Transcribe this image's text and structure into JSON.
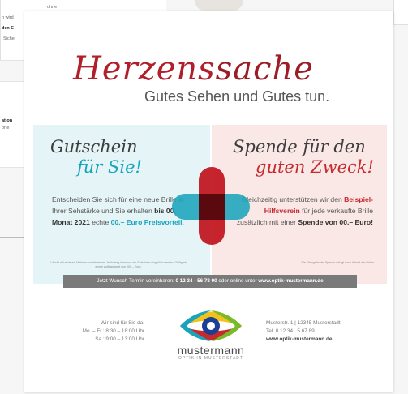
{
  "background": {
    "top_fragments": [
      "ohne",
      "n wird",
      "den E",
      "Siche"
    ],
    "mid_fragments": [
      "ation",
      "orte"
    ]
  },
  "flyer": {
    "title_part1": "Herzens",
    "title_part2": "sache",
    "subtitle": "Gutes Sehen und Gutes tun.",
    "left_panel": {
      "heading_line1": "Gutschein",
      "heading_line2": "für Sie!",
      "text_before": "Entscheiden Sie sich für eine neue Brille in Ihrer Sehstärke und Sie erhalten ",
      "text_bold": "bis 00. Monat 2021",
      "text_mid": " echte ",
      "text_highlight": "00.– Euro Preisvorteil.",
      "footnote": "* Nicht mit anderen Aktionen kombinierbar. Je Auftrag kann nur ein Gutschein eingelöst werden. Gültig ab einem Auftragswert von 000.– Euro."
    },
    "right_panel": {
      "heading_line1": "Spende für den",
      "heading_line2": "guten Zweck!",
      "text_before": "Gleichzeitig unterstützen wir den ",
      "text_highlight": "Beispiel-Hilfsverein",
      "text_mid": " für jede verkaufte Brille zusätzlich mit einer ",
      "text_bold": "Spende von 00.– Euro!",
      "footnote": "Die Übergabe der Spende erfolgt nach Ablauf der Aktion."
    },
    "booking": {
      "prefix": "Jetzt Wunsch-Termin vereinbaren: ",
      "phone": "0 12 34 - 56 78 90",
      "middle": " oder online unter ",
      "url": "www.optik-mustermann.de"
    },
    "hours": {
      "heading": "Wir sind für Sie da:",
      "weekdays": "Mo. – Fr.:  8:30 – 18:00 Uhr",
      "saturday": "Sa.:  9:00 – 13:00 Uhr"
    },
    "logo": {
      "word": "mustermann",
      "sub": "OPTIK IN MUSTERSTADT"
    },
    "address": {
      "street": "Musterstr. 1 | 12345 Musterstadt",
      "phone": "Tel. 0 12 34 . 5 67 89",
      "url": "www.optik-mustermann.de"
    },
    "colors": {
      "accent_red": "#c52a2f",
      "accent_teal": "#1aa4bc",
      "logo_yellow": "#f2c21a",
      "logo_blue": "#1b3f94"
    }
  }
}
